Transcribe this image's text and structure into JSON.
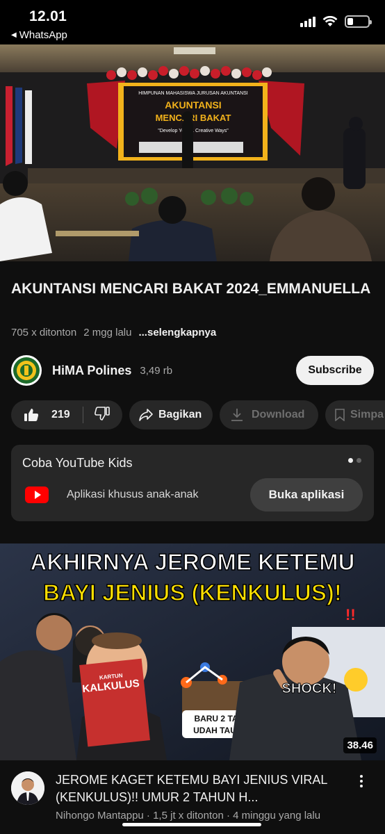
{
  "status_bar": {
    "time": "12.01",
    "back_app": "WhatsApp",
    "battery_level": 0.3
  },
  "video": {
    "banner_line1": "HIMPUNAN MAHASISWA JURUSAN AKUNTANSI",
    "banner_line2": "AKUNTANSI",
    "banner_line3": "MENCARI BAKAT",
    "banner_tagline": "\"Develop Your ... Creative Ways\""
  },
  "title": "AKUNTANSI MENCARI BAKAT 2024_EMMANUELLA",
  "meta": {
    "views": "705 x ditonton",
    "age": "2 mgg lalu",
    "more": "...selengkapnya"
  },
  "channel": {
    "name": "HiMA Polines",
    "subscribers": "3,49 rb",
    "subscribe_label": "Subscribe"
  },
  "actions": {
    "likes": "219",
    "share": "Bagikan",
    "download": "Download",
    "save": "Simpa"
  },
  "kids_card": {
    "title": "Coba YouTube Kids",
    "subtitle": "Aplikasi khusus anak-anak",
    "button": "Buka aplikasi"
  },
  "next_video": {
    "thumb_headline1": "AKHIRNYA JEROME KETEMU",
    "thumb_headline2": "BAYI JENIUS (KENKULUS)!",
    "thumb_book_top": "KARTUN",
    "thumb_book_title": "KALKULUS",
    "thumb_shock": "SHOCK!",
    "thumb_caption1": "BARU 2 TAHUN",
    "thumb_caption2": "UDAH TAU INI!?",
    "duration": "38.46",
    "title": "JEROME KAGET KETEMU BAYI JENIUS VIRAL (KENKULUS)!! UMUR 2 TAHUN H...",
    "meta": "Nihongo Mantappu · 1,5 jt x ditonton · 4 minggu yang lalu"
  }
}
